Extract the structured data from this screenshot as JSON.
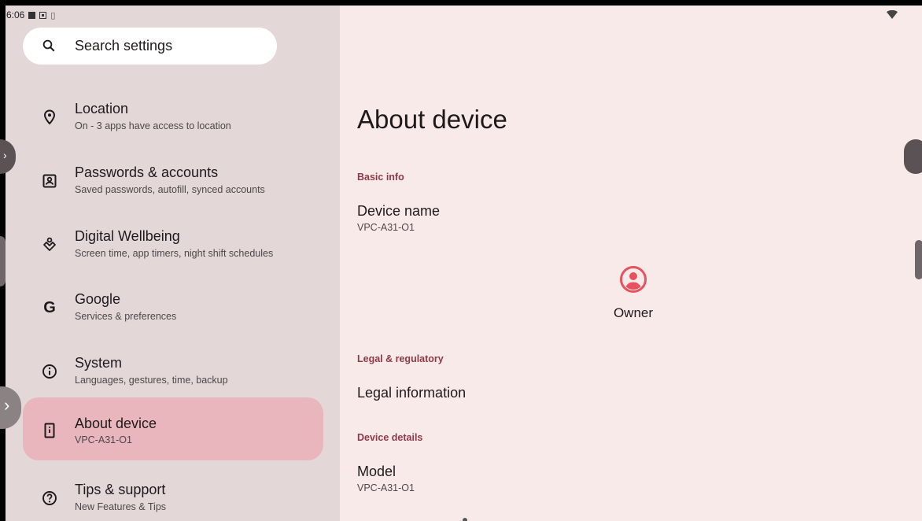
{
  "status_bar": {
    "time": "6:06"
  },
  "search": {
    "placeholder": "Search settings"
  },
  "menu": [
    {
      "title": "Location",
      "subtitle": "On - 3 apps have access to location",
      "icon": "location-pin-icon"
    },
    {
      "title": "Passwords & accounts",
      "subtitle": "Saved passwords, autofill, synced accounts",
      "icon": "account-box-icon"
    },
    {
      "title": "Digital Wellbeing",
      "subtitle": "Screen time, app timers, night shift schedules",
      "icon": "wellbeing-icon"
    },
    {
      "title": "Google",
      "subtitle": "Services & preferences",
      "icon": "google-g-icon"
    },
    {
      "title": "System",
      "subtitle": "Languages, gestures, time, backup",
      "icon": "info-icon"
    },
    {
      "title": "About device",
      "subtitle": "VPC-A31-O1",
      "icon": "device-icon",
      "selected": true
    },
    {
      "title": "Tips & support",
      "subtitle": "New Features & Tips",
      "icon": "help-icon"
    }
  ],
  "detail": {
    "title": "About device",
    "basic_info_header": "Basic info",
    "device_name_label": "Device name",
    "device_name_value": "VPC-A31-O1",
    "owner_label": "Owner",
    "legal_header": "Legal & regulatory",
    "legal_info_label": "Legal information",
    "device_details_header": "Device details",
    "model_label": "Model",
    "model_value": "VPC-A31-O1"
  },
  "colors": {
    "accent": "#e8525f",
    "selected_bg": "#e9b6bd",
    "section_header": "#8f3a48"
  }
}
